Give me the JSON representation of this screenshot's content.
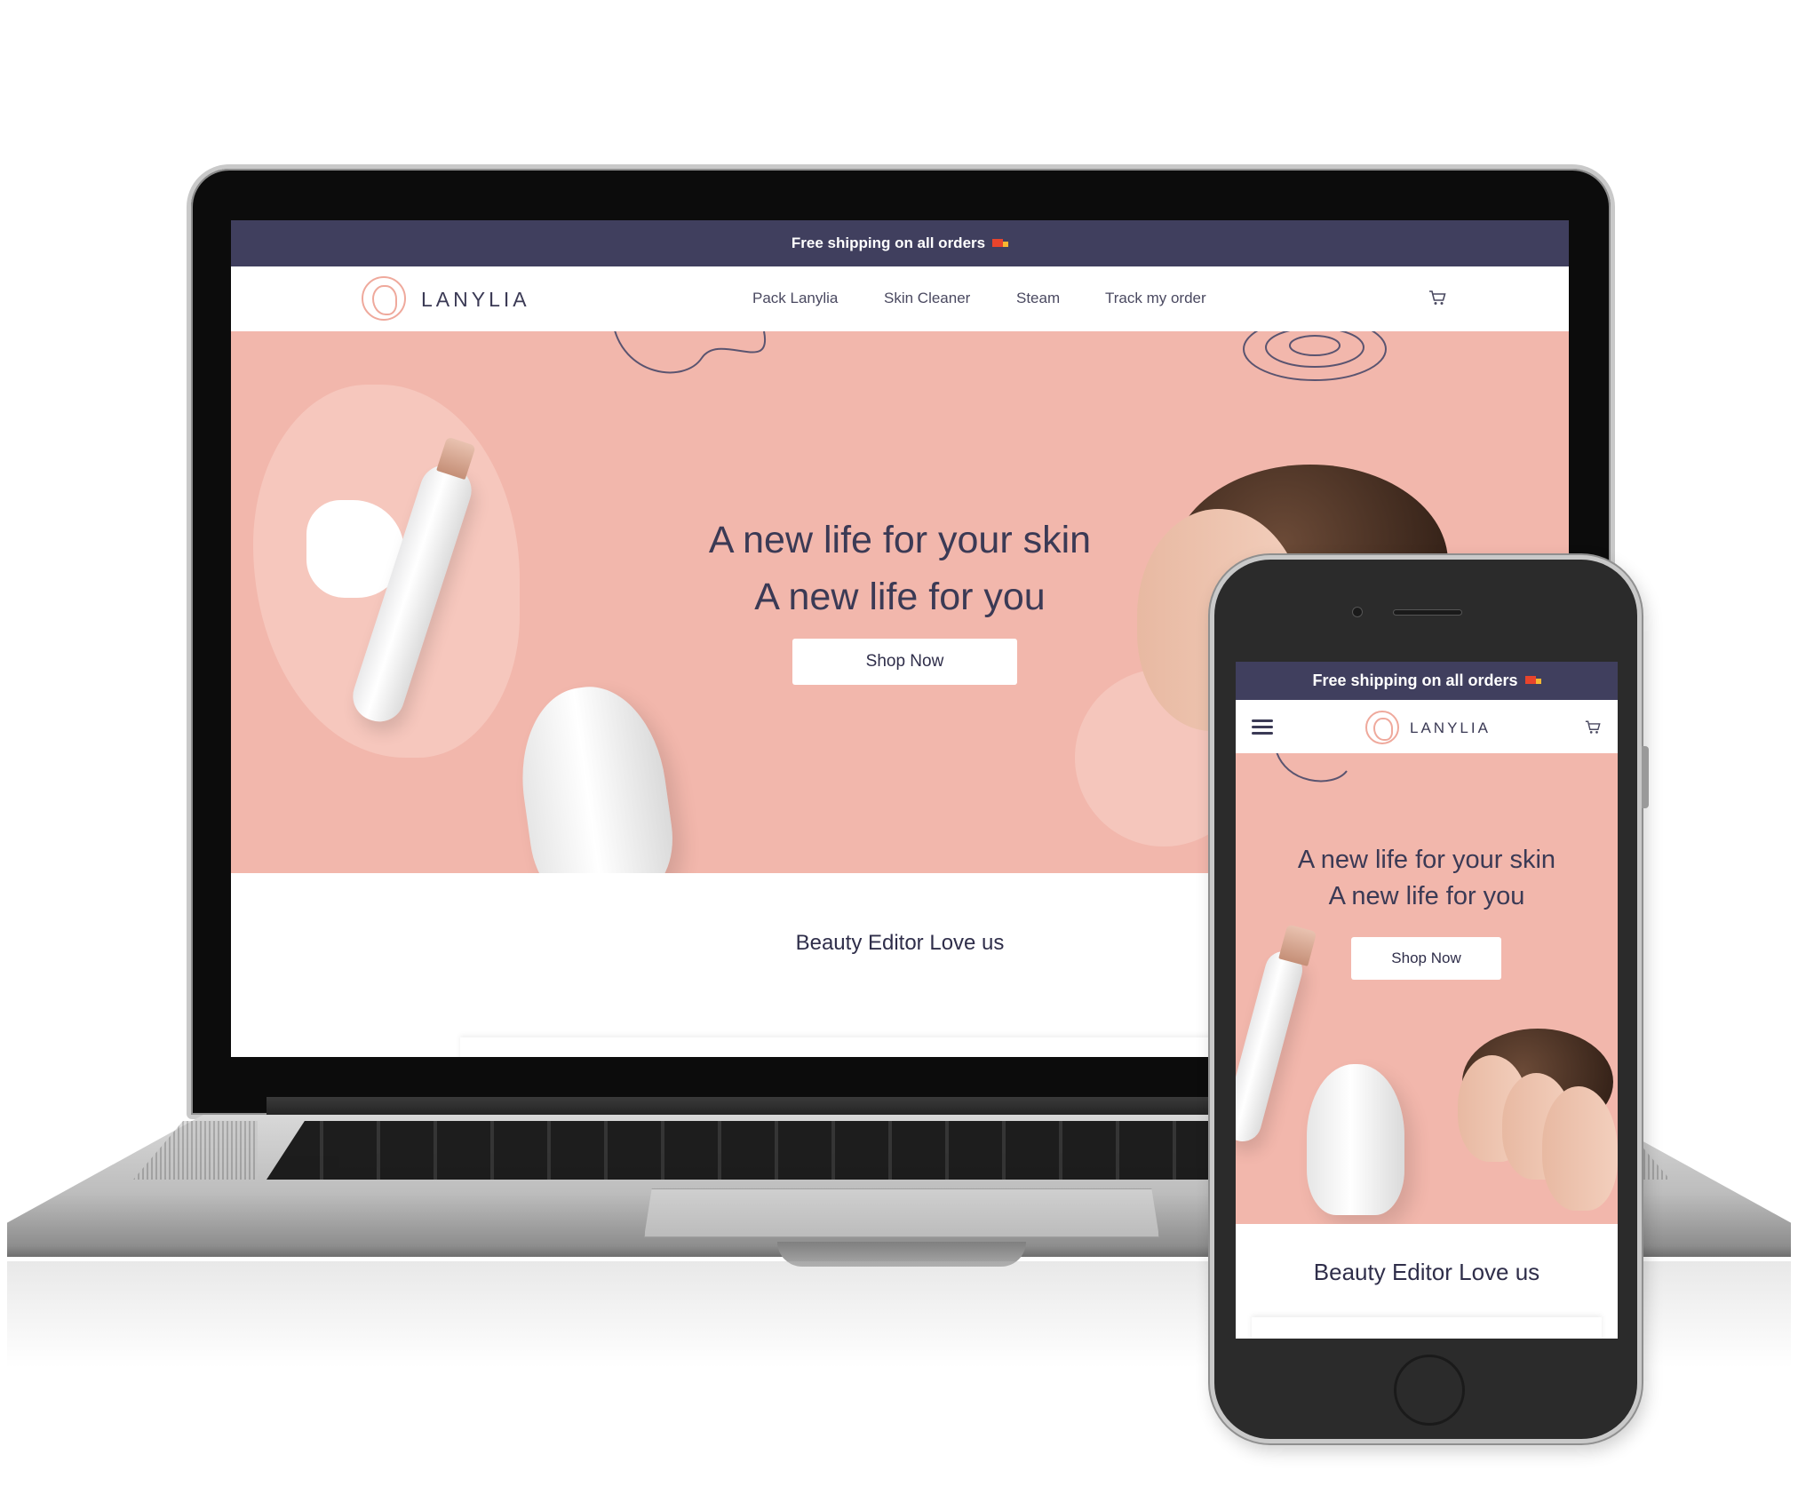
{
  "banner": {
    "text": "Free shipping on all orders",
    "icon": "truck-icon"
  },
  "brand": {
    "name": "LANYLIA"
  },
  "nav": {
    "items": [
      {
        "label": "Pack Lanylia"
      },
      {
        "label": "Skin Cleaner"
      },
      {
        "label": "Steam"
      },
      {
        "label": "Track my order"
      }
    ]
  },
  "hero": {
    "line1": "A new life for your skin",
    "line2": "A new life for you",
    "cta": "Shop Now"
  },
  "section": {
    "title": "Beauty Editor Love us"
  },
  "colors": {
    "banner_bg": "#403f5e",
    "hero_bg": "#f2b7ac",
    "text_dark": "#3b3a55",
    "logo_accent": "#efa99c"
  },
  "icons": [
    "cart-icon",
    "menu-icon",
    "logo-icon",
    "truck-icon"
  ]
}
